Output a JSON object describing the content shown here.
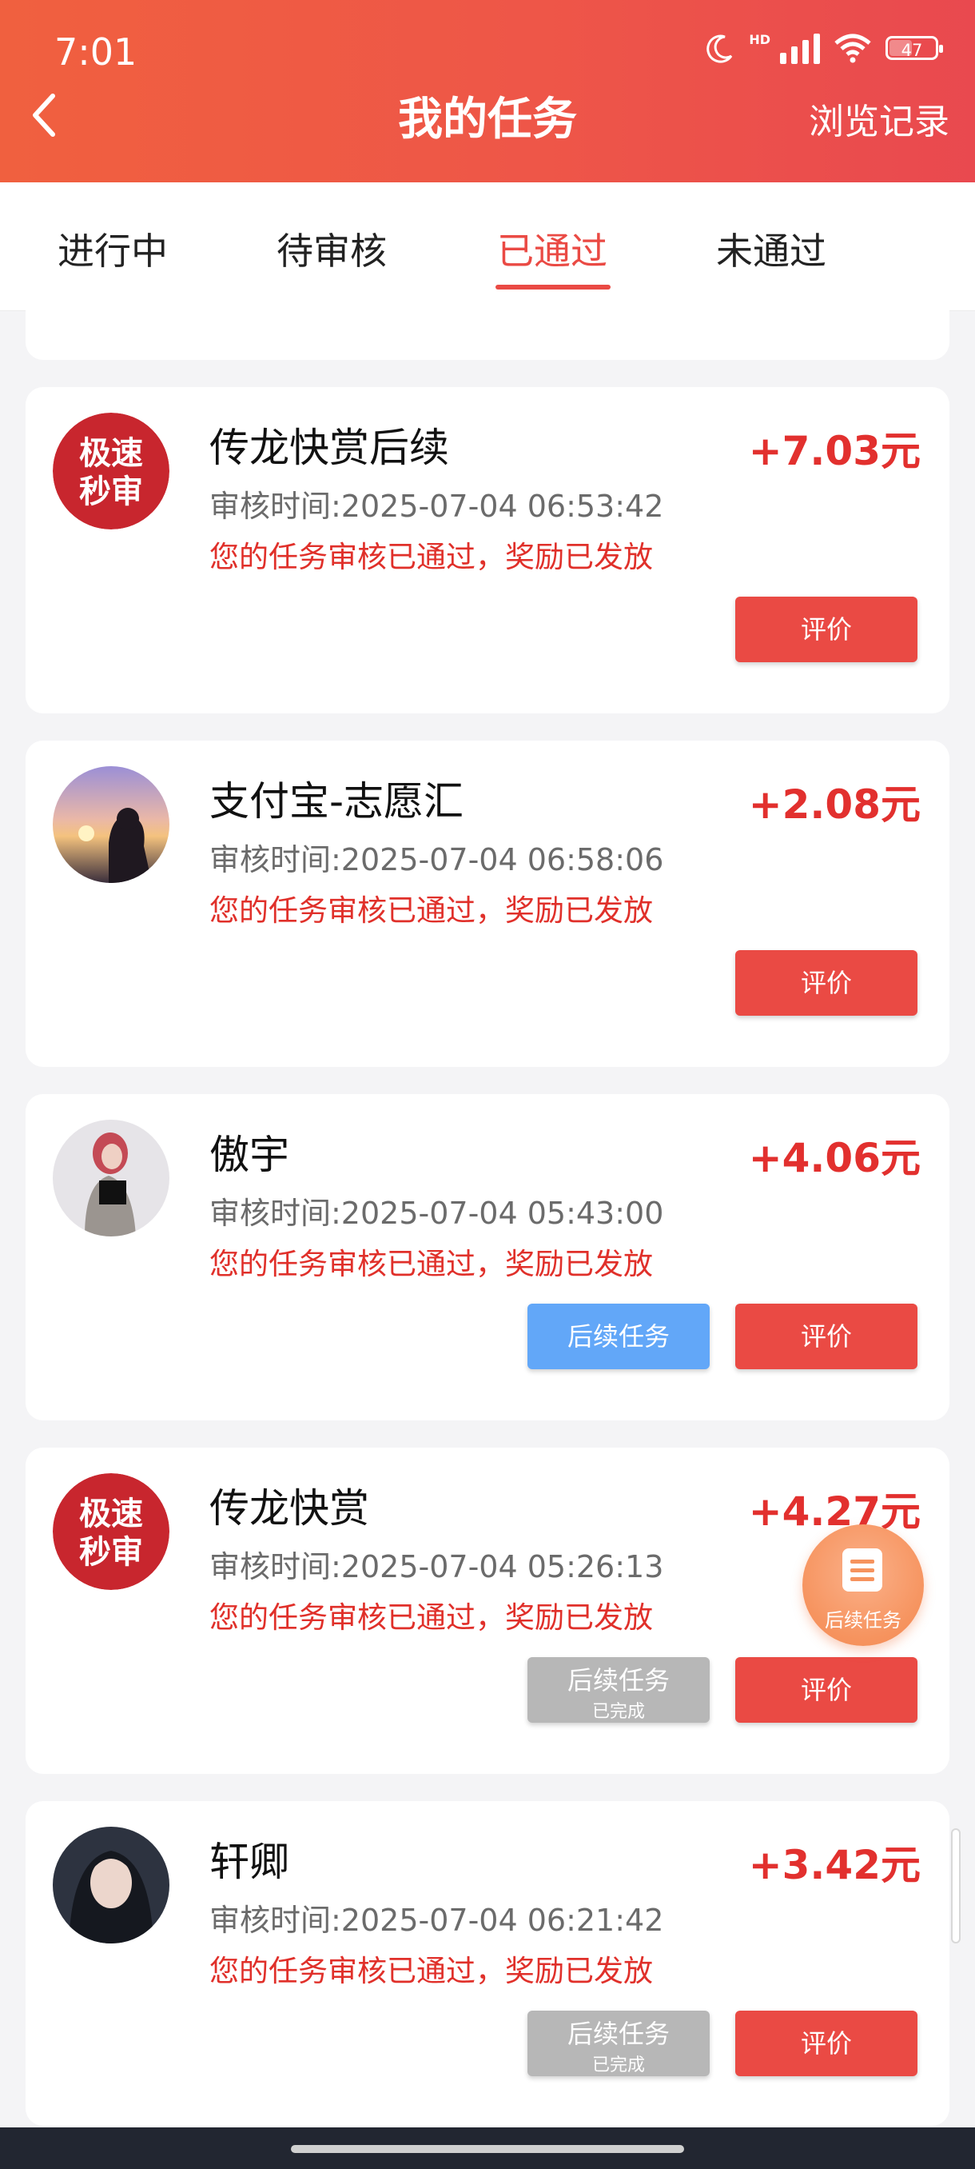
{
  "status_bar": {
    "time": "7:01",
    "network": "HD",
    "battery": "47"
  },
  "header": {
    "title": "我的任务",
    "history_label": "浏览记录"
  },
  "tabs": [
    {
      "label": "进行中",
      "active": false
    },
    {
      "label": "待审核",
      "active": false
    },
    {
      "label": "已通过",
      "active": true
    },
    {
      "label": "未通过",
      "active": false
    }
  ],
  "cards": [
    {
      "avatar": "badge-avatar",
      "avatar_text": [
        "极速",
        "秒审"
      ],
      "name": "传龙快赏后续",
      "reward": "+7.03元",
      "review_time": "审核时间:2025-07-04 06:53:42",
      "status": "您的任务审核已通过，奖励已发放",
      "rate_label": "评价"
    },
    {
      "avatar": "sunset-avatar",
      "name": "支付宝-志愿汇",
      "reward": "+2.08元",
      "review_time": "审核时间:2025-07-04 06:58:06",
      "status": "您的任务审核已通过，奖励已发放",
      "rate_label": "评价"
    },
    {
      "avatar": "portrait-avatar",
      "name": "傲宇",
      "reward": "+4.06元",
      "review_time": "审核时间:2025-07-04 05:43:00",
      "status": "您的任务审核已通过，奖励已发放",
      "follow_label": "后续任务",
      "rate_label": "评价"
    },
    {
      "avatar": "badge-avatar",
      "avatar_text": [
        "极速",
        "秒审"
      ],
      "name": "传龙快赏",
      "reward": "+4.27元",
      "review_time": "审核时间:2025-07-04 05:26:13",
      "status": "您的任务审核已通过，奖励已发放",
      "follow_label": "后续任务",
      "follow_sub": "已完成",
      "rate_label": "评价"
    },
    {
      "avatar": "portrait-avatar",
      "name": "轩卿",
      "reward": "+3.42元",
      "review_time": "审核时间:2025-07-04 06:21:42",
      "status": "您的任务审核已通过，奖励已发放",
      "follow_label": "后续任务",
      "follow_sub": "已完成",
      "rate_label": "评价"
    }
  ],
  "floating_button": {
    "label": "后续任务",
    "icon": "document-icon"
  },
  "colors": {
    "primary": "#ea4a44",
    "reward": "#e2302e",
    "follow": "#62a7f8",
    "done": "#b7b7b7"
  }
}
